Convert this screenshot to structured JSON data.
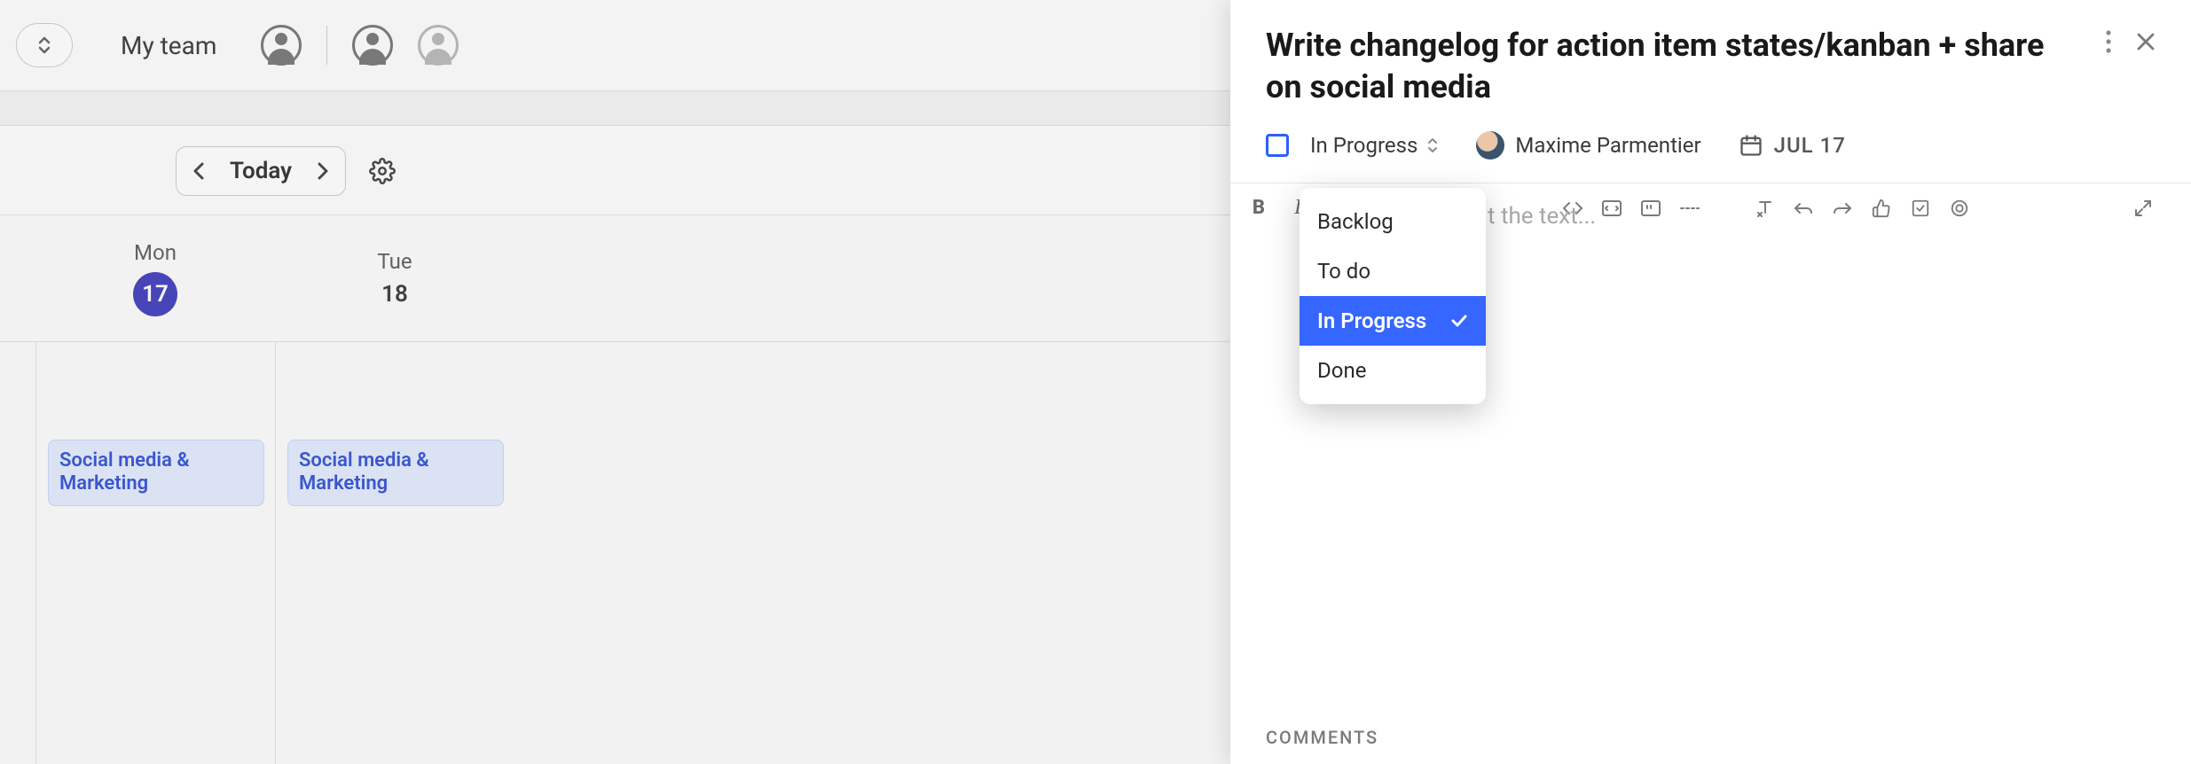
{
  "background": {
    "team_label": "My team",
    "today_label": "Today",
    "days": [
      {
        "label": "Mon",
        "date": "17",
        "today": true
      },
      {
        "label": "Tue",
        "date": "18",
        "today": false
      }
    ],
    "events": [
      {
        "title": "Social media & Marketing"
      },
      {
        "title": "Social media & Marketing"
      }
    ]
  },
  "panel": {
    "title": "Write changelog for action item states/kanban + share on social media",
    "status": {
      "current": "In Progress",
      "options": [
        "Backlog",
        "To do",
        "In Progress",
        "Done"
      ]
    },
    "assignee": {
      "name": "Maxime Parmentier"
    },
    "due_date": "JUL 17",
    "editor_placeholder": "t the text...",
    "comments_label": "COMMENTS"
  }
}
